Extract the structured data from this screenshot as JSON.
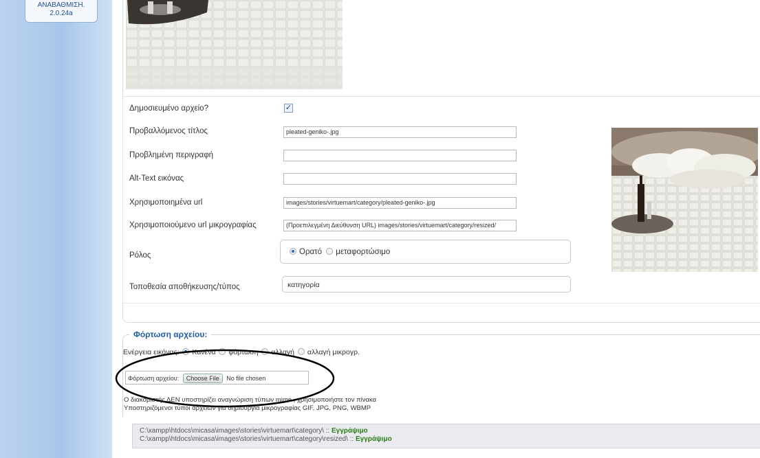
{
  "sidebar": {
    "version_line1": "ΑΝΑΒΑΘΜΙΣΗ.",
    "version_line2": "2.0.24a"
  },
  "form": {
    "published_label": "Δημοσιευμένο αρχείο?",
    "published_checked": true,
    "displayed_title_label": "Προβαλλόμενος τίτλος",
    "displayed_title_value": "pleated-geniko-.jpg",
    "description_label": "Προβλημένη περιγραφή",
    "description_value": "",
    "alt_text_label": "Alt-Text εικόνας",
    "alt_text_value": "",
    "url_label": "Χρησιμοποιημένα url",
    "url_value": "images/stories/virtuemart/category/pleated-geniko-.jpg",
    "thumb_url_label": "Χρησιμοποιούμενο url μικρογραφίας",
    "thumb_url_value": "(Προεπιλεγμένη Διεύθυνση URL) images/stories/virtuemart/category/resized/",
    "role_label": "Ρόλος",
    "role_option_visible": "Ορατό",
    "role_option_download": "μεταφορτώσιμο",
    "storage_label": "Τοποθεσία αποθήκευσης/τύπος",
    "storage_value": "κατηγορία"
  },
  "upload": {
    "legend": "Φόρτωση αρχείου:",
    "action_label": "Ενέργεια εικόνας:",
    "action_none": "Κανένα",
    "action_upload": "φόρτωση",
    "action_replace": "αλλαγή",
    "action_replace_thumb": "αλλαγή μικρογρ.",
    "file_label": "Φόρτωση αρχείου:",
    "choose_button": "Choose File",
    "no_file": "No file chosen",
    "note1": "Ο διακομιστής ΔΕΝ υποστηρίζει αναγνώριση τύπων mime , χρησιμοποιήστε τον πίνακα",
    "note2": "Υποστηριζόμενοι τύποι αρχείων για δημιουργία μικρογραφίας GIF, JPG, PNG, WBMP"
  },
  "paths": {
    "path1": "C:\\xampp\\htdocs\\micasa\\images\\stories\\virtuemart\\category\\ :: ",
    "status1": "Εγγράψιμο",
    "path2": "C:\\xampp\\htdocs\\micasa\\images\\stories\\virtuemart\\category\\resized\\ :: ",
    "status2": "Εγγράψιμο"
  },
  "colors": {
    "accent": "#1f5f9f",
    "ok": "#2f7d1a",
    "sidebar": "#a8c6ea"
  }
}
